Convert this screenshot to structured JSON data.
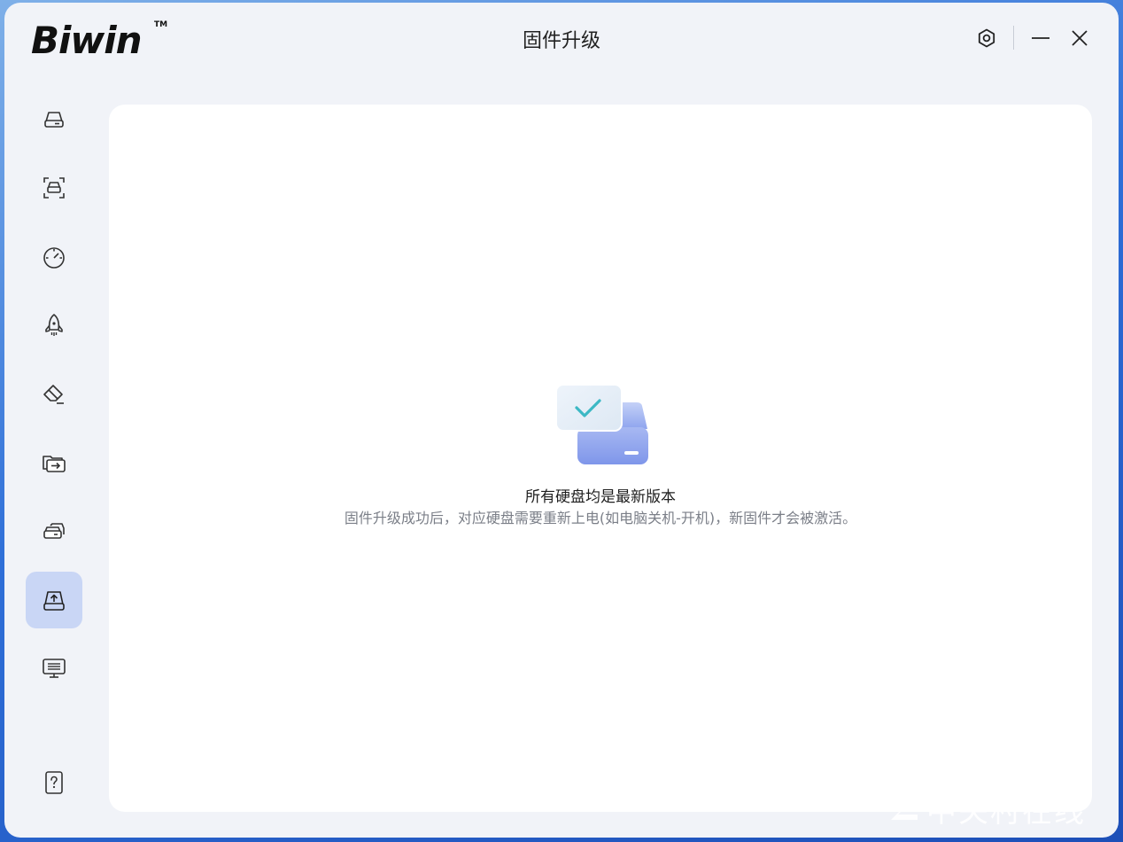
{
  "app": {
    "brand": "Biwin",
    "trademark": "TM",
    "window_title": "固件升级"
  },
  "window_controls": {
    "settings_icon": "settings-hexagon-icon",
    "minimize_icon": "minimize-icon",
    "close_icon": "close-icon"
  },
  "sidebar": {
    "items": [
      {
        "icon": "drive-icon",
        "active": false
      },
      {
        "icon": "drive-scan-icon",
        "active": false
      },
      {
        "icon": "speed-gauge-icon",
        "active": false
      },
      {
        "icon": "rocket-icon",
        "active": false
      },
      {
        "icon": "eraser-icon",
        "active": false
      },
      {
        "icon": "folder-transfer-icon",
        "active": false
      },
      {
        "icon": "drive-clone-icon",
        "active": false
      },
      {
        "icon": "firmware-upgrade-icon",
        "active": true
      },
      {
        "icon": "monitor-info-icon",
        "active": false
      },
      {
        "icon": "help-icon",
        "active": false
      }
    ]
  },
  "status": {
    "title": "所有硬盘均是最新版本",
    "description": "固件升级成功后，对应硬盘需要重新上电(如电脑关机-开机)，新固件才会被激活。"
  },
  "watermark": {
    "text": "中关村在线"
  },
  "colors": {
    "window_bg": "#f1f3f8",
    "content_bg": "#ffffff",
    "active_nav_bg": "#c9d6f5",
    "check_accent": "#3bb8c4",
    "drive_blue": "#8aa2ef"
  }
}
